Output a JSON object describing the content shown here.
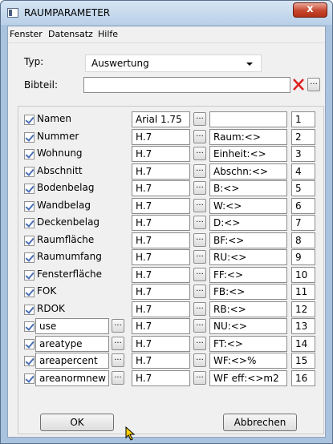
{
  "window": {
    "title": "RAUMPARAMETER",
    "close_glyph": "x"
  },
  "menu": {
    "items": [
      "Fenster",
      "Datensatz",
      "Hilfe"
    ]
  },
  "typ": {
    "label": "Typ:",
    "value": "Auswertung"
  },
  "bibteil": {
    "label": "Bibteil:",
    "value": ""
  },
  "browse_label": "...",
  "rows": [
    {
      "label": "Namen",
      "font": "Arial 1.75",
      "format": "",
      "number": "1",
      "checked": true
    },
    {
      "label": "Nummer",
      "font": "H.7",
      "format": "Raum:<>",
      "number": "2",
      "checked": true
    },
    {
      "label": "Wohnung",
      "font": "H.7",
      "format": "Einheit:<>",
      "number": "3",
      "checked": true
    },
    {
      "label": "Abschnitt",
      "font": "H.7",
      "format": "Abschn:<>",
      "number": "4",
      "checked": true
    },
    {
      "label": "Bodenbelag",
      "font": "H.7",
      "format": "B:<>",
      "number": "5",
      "checked": true
    },
    {
      "label": "Wandbelag",
      "font": "H.7",
      "format": "W:<>",
      "number": "6",
      "checked": true
    },
    {
      "label": "Deckenbelag",
      "font": "H.7",
      "format": "D:<>",
      "number": "7",
      "checked": true
    },
    {
      "label": "Raumfläche",
      "font": "H.7",
      "format": "BF:<>",
      "number": "8",
      "checked": true
    },
    {
      "label": "Raumumfang",
      "font": "H.7",
      "format": "RU:<>",
      "number": "9",
      "checked": true
    },
    {
      "label": "Fensterfläche",
      "font": "H.7",
      "format": "FF:<>",
      "number": "10",
      "checked": true
    },
    {
      "label": "FOK",
      "font": "H.7",
      "format": "FB:<>",
      "number": "11",
      "checked": true
    },
    {
      "label": "RDOK",
      "font": "H.7",
      "format": "RB:<>",
      "number": "12",
      "checked": true
    }
  ],
  "custom_rows": [
    {
      "name": "use",
      "font": "H.7",
      "format": "NU:<>",
      "number": "13",
      "checked": true
    },
    {
      "name": "areatype",
      "font": "H.7",
      "format": "FT:<>",
      "number": "14",
      "checked": true
    },
    {
      "name": "areapercent",
      "font": "H.7",
      "format": "WF:<>%",
      "number": "15",
      "checked": true
    },
    {
      "name": "areanormnew",
      "font": "H.7",
      "format": "WF eff:<>m2",
      "number": "16",
      "checked": true
    }
  ],
  "buttons": {
    "ok": "OK",
    "cancel": "Abbrechen"
  },
  "colors": {
    "close_red": "#c7462e",
    "check_blue": "#4a6fb5",
    "delete_red": "#e02020"
  }
}
